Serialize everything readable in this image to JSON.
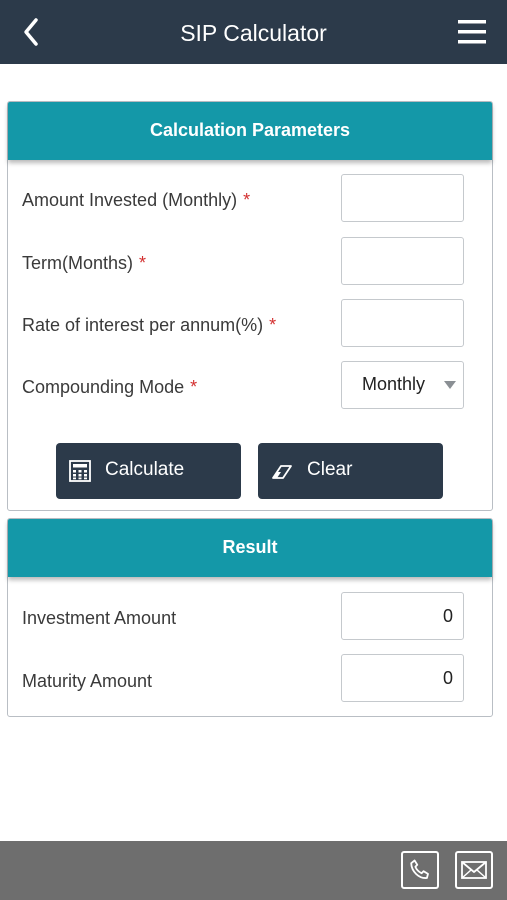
{
  "header": {
    "title": "SIP Calculator",
    "back_icon": "chevron-left-icon",
    "menu_icon": "hamburger-menu-icon"
  },
  "params": {
    "title": "Calculation Parameters",
    "required_mark": "*",
    "amount_label": "Amount Invested (Monthly)",
    "amount_value": "",
    "term_label": "Term(Months)",
    "term_value": "",
    "rate_label": "Rate of interest per annum(%)",
    "rate_value": "",
    "mode_label": "Compounding Mode",
    "mode_value": "Monthly"
  },
  "buttons": {
    "calculate": "Calculate",
    "calculate_icon": "calculator-icon",
    "clear": "Clear",
    "clear_icon": "eraser-icon"
  },
  "result": {
    "title": "Result",
    "investment_label": "Investment Amount",
    "investment_value": "0",
    "maturity_label": "Maturity Amount",
    "maturity_value": "0"
  },
  "footer": {
    "phone_icon": "phone-icon",
    "mail_icon": "mail-icon"
  },
  "colors": {
    "header_bg": "#2c3a4a",
    "accent": "#1498a8",
    "required": "#d32f2f",
    "footer_bg": "#6e6e6e"
  }
}
